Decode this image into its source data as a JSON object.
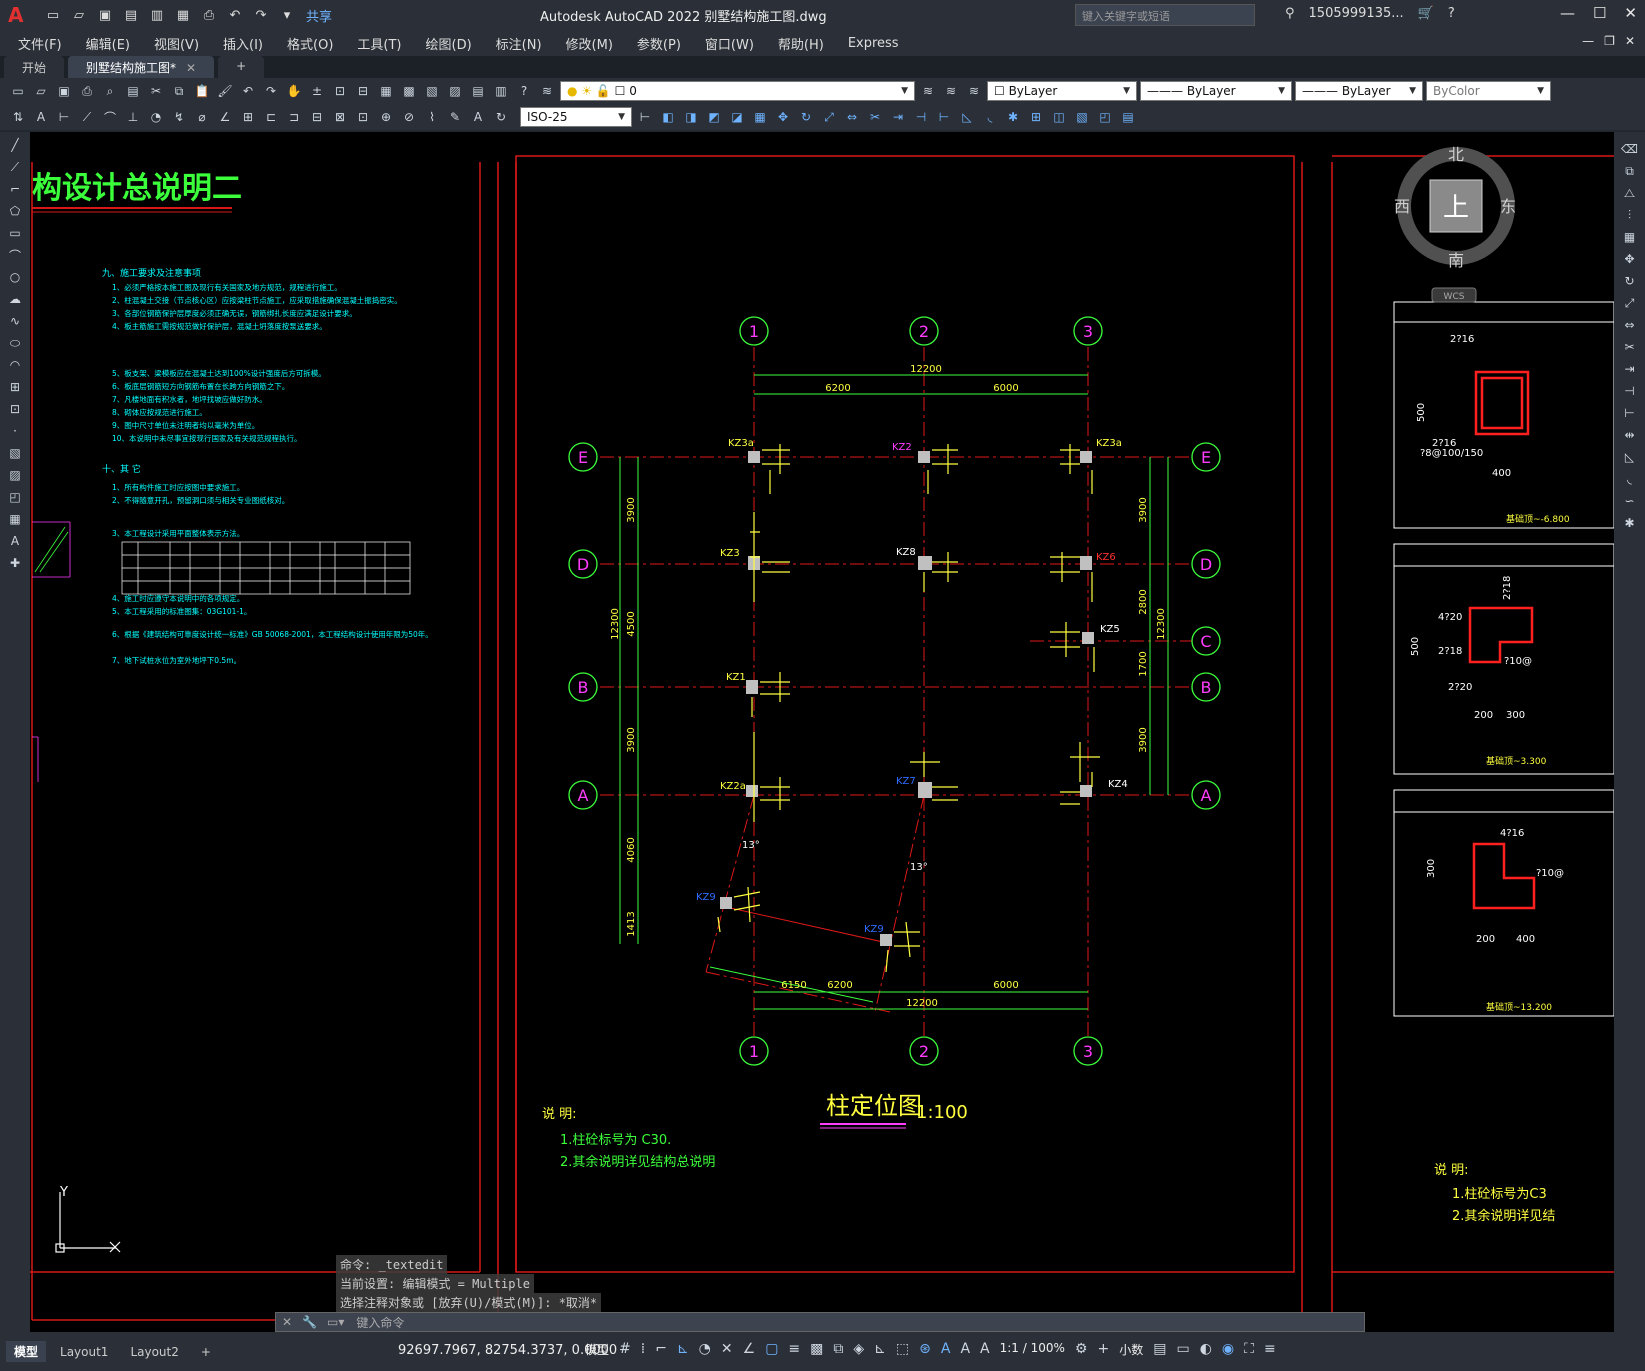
{
  "titlebar": {
    "logo": "A",
    "share": "共享",
    "title": "Autodesk AutoCAD 2022    别墅结构施工图.dwg",
    "search_placeholder": "键入关键字或短语",
    "user": "1505999135...",
    "help": "?"
  },
  "menu": [
    "文件(F)",
    "编辑(E)",
    "视图(V)",
    "插入(I)",
    "格式(O)",
    "工具(T)",
    "绘图(D)",
    "标注(N)",
    "修改(M)",
    "参数(P)",
    "窗口(W)",
    "帮助(H)",
    "Express"
  ],
  "tabs": {
    "start": "开始",
    "active": "别墅结构施工图*",
    "close": "✕",
    "add": "+"
  },
  "toolbar": {
    "layer": "0",
    "color": "ByLayer",
    "linetype": "ByLayer",
    "lineweight": "ByLayer",
    "plotstyle": "ByColor",
    "dimstyle": "ISO-25"
  },
  "drawing": {
    "left_title": "构设计总说明二",
    "left_heading_9": "九、施工要求及注意事项",
    "left_heading_10": "十、其 它",
    "left_items": [
      "1、必须严格按本施工图及现行有关国家及地方规范，规程进行施工。",
      "2、柱混凝土交接（节点核心区）应按梁柱节点施工，应采取措施确保混凝土振捣密实。",
      "3、各部位钢筋保护层厚度必须正确无误，钢筋绑扎长度应满足设计要求。",
      "4、板主筋施工需按规范做好保护层，混凝土坍落度按泵送要求。",
      "5、板支架、梁模板应在混凝土达到100%设计强度后方可拆模。",
      "6、板底层钢筋短方向钢筋布置在长跨方向钢筋之下。",
      "7、凡楼地面有积水者，地坪找坡应做好防水。",
      "8、砌体应按规范进行施工。",
      "9、图中尺寸单位未注明者均以毫米为单位。",
      "10、本说明中未尽事宜按现行国家及有关规范规程执行。"
    ],
    "other_items": [
      "1、所有构件施工时应按图中要求施工。",
      "2、不得随意开孔，预留洞口须与相关专业图纸核对。",
      "3、本工程设计采用平面整体表示方法。",
      "4、施工时应遵守本说明中的各项规定。",
      "5、本工程采用的标准图集：03G101-1。",
      "6、根据《建筑结构可靠度设计统一标准》GB 50068-2001，本工程结构设计使用年限为50年。",
      "7、地下试桩水位为室外地坪下0.5m。"
    ],
    "title": "柱定位图",
    "scale": "1:100",
    "note_heading": "说 明:",
    "notes": [
      "1.柱砼标号为 C30.",
      "2.其余说明详见结构总说明"
    ],
    "right_note_heading": "说 明:",
    "right_notes": [
      "1.柱砼标号为C3",
      "2.其余说明详见结"
    ],
    "axes_top": [
      "1",
      "2",
      "3"
    ],
    "axes_side": [
      "E",
      "D",
      "C",
      "B",
      "A"
    ],
    "dims_top": [
      "12200",
      "6200",
      "6000"
    ],
    "dims_bottom": [
      "6150",
      "6200",
      "6000",
      "12200"
    ],
    "dims_left": [
      "3900",
      "4500",
      "12300",
      "3900",
      "4060",
      "1413"
    ],
    "dims_right": [
      "3900",
      "2800",
      "12300",
      "1700",
      "3900"
    ],
    "columns": [
      "KZ3a",
      "KZ2",
      "KZ3a",
      "KZ3",
      "KZ8",
      "KZ6",
      "KZ5",
      "KZ1",
      "KZ2a",
      "KZ7",
      "KZ4",
      "KZ9",
      "KZ9"
    ],
    "angle_label": "13°",
    "section_labels": [
      "基础顶~-6.800",
      "基础顶~3.300",
      "基础顶~13.200"
    ],
    "section_rebar": [
      "2?16",
      "2?16",
      "400",
      "500",
      "?8@100/150",
      "2?18",
      "4?20",
      "2?18",
      "2?20",
      "?10@",
      "200",
      "300",
      "4?16",
      "?10@",
      "200",
      "400",
      "300",
      "500"
    ],
    "compass": {
      "north": "北",
      "south": "南",
      "east": "东",
      "west": "西",
      "top": "上",
      "wcs": "WCS"
    }
  },
  "commands": {
    "history": [
      "命令: _textedit",
      "当前设置: 编辑模式 = Multiple",
      "选择注释对象或 [放弃(U)/模式(M)]: *取消*"
    ],
    "placeholder": "键入命令"
  },
  "status": {
    "layouts": [
      "模型",
      "Layout1",
      "Layout2"
    ],
    "coords": "92697.7967, 82754.3737, 0.0000",
    "model": "模型",
    "scale": "1:1 / 100%",
    "units": "小数"
  }
}
